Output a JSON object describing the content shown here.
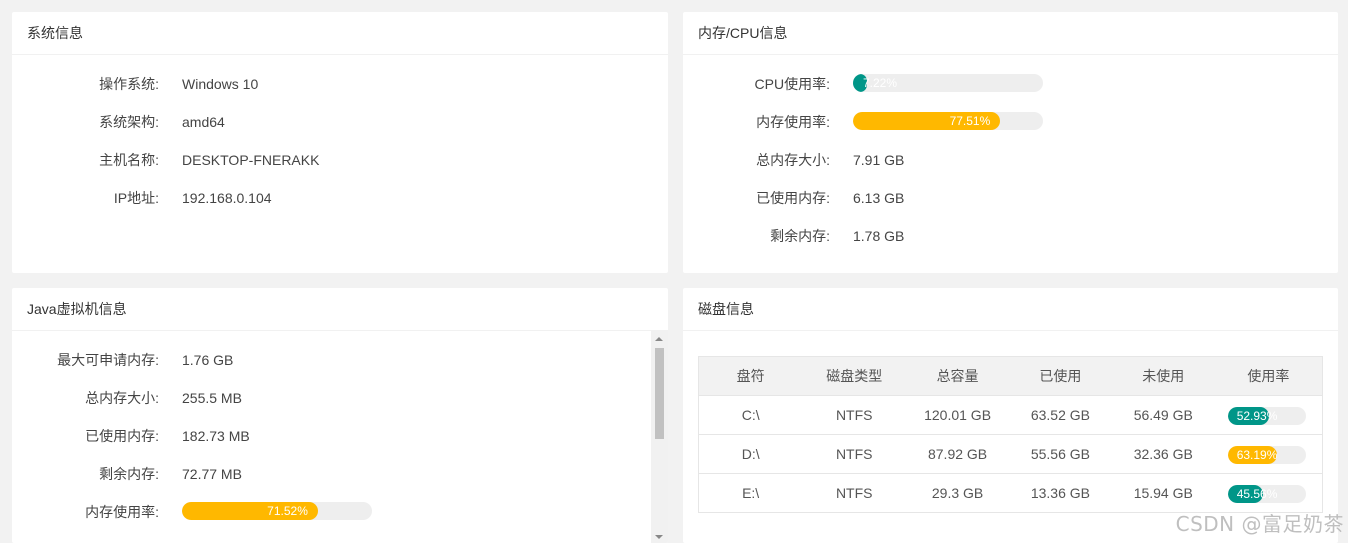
{
  "system": {
    "title": "系统信息",
    "rows": [
      {
        "label": "操作系统:",
        "value": "Windows 10"
      },
      {
        "label": "系统架构:",
        "value": "amd64"
      },
      {
        "label": "主机名称:",
        "value": "DESKTOP-FNERAKK"
      },
      {
        "label": "IP地址:",
        "value": "192.168.0.104"
      }
    ]
  },
  "memcpu": {
    "title": "内存/CPU信息",
    "cpu_label": "CPU使用率:",
    "cpu_usage_text": "7.22%",
    "cpu_usage": 7.22,
    "mem_label": "内存使用率:",
    "mem_usage_text": "77.51%",
    "mem_usage": 77.51,
    "rows": [
      {
        "label": "总内存大小:",
        "value": "7.91 GB"
      },
      {
        "label": "已使用内存:",
        "value": "6.13 GB"
      },
      {
        "label": "剩余内存:",
        "value": "1.78 GB"
      }
    ],
    "colors": {
      "cpu": "#009688",
      "mem": "#ffb800"
    }
  },
  "jvm": {
    "title": "Java虚拟机信息",
    "rows": [
      {
        "label": "最大可申请内存:",
        "value": "1.76 GB"
      },
      {
        "label": "总内存大小:",
        "value": "255.5 MB"
      },
      {
        "label": "已使用内存:",
        "value": "182.73 MB"
      },
      {
        "label": "剩余内存:",
        "value": "72.77 MB"
      }
    ],
    "mem_label": "内存使用率:",
    "mem_usage_text": "71.52%",
    "mem_usage": 71.52
  },
  "disk": {
    "title": "磁盘信息",
    "headers": [
      "盘符",
      "磁盘类型",
      "总容量",
      "已使用",
      "未使用",
      "使用率"
    ],
    "rows": [
      {
        "drive": "C:\\",
        "type": "NTFS",
        "total": "120.01 GB",
        "used": "63.52 GB",
        "free": "56.49 GB",
        "usage_text": "52.93%",
        "usage": 52.93,
        "color": "#009688"
      },
      {
        "drive": "D:\\",
        "type": "NTFS",
        "total": "87.92 GB",
        "used": "55.56 GB",
        "free": "32.36 GB",
        "usage_text": "63.19%",
        "usage": 63.19,
        "color": "#ffb800"
      },
      {
        "drive": "E:\\",
        "type": "NTFS",
        "total": "29.3 GB",
        "used": "13.36 GB",
        "free": "15.94 GB",
        "usage_text": "45.56%",
        "usage": 45.56,
        "color": "#009688"
      }
    ]
  },
  "watermark": "CSDN @富足奶茶"
}
